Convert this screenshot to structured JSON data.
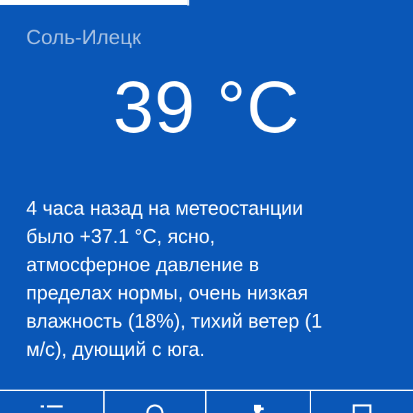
{
  "weather": {
    "city": "Соль-Илецк",
    "temperature": "39 °C",
    "description_lines": [
      "4 часа назад на метеостанции",
      "было +37.1 °C, ясно,",
      "атмосферное давление в",
      "пределах нормы, очень низкая",
      "влажность (18%), тихий ветер (1",
      "м/с), дующий с юга."
    ]
  },
  "toolbar": {
    "buttons": [
      {
        "icon": "list-icon"
      },
      {
        "icon": "search-icon"
      },
      {
        "icon": "wrench-icon"
      },
      {
        "icon": "window-icon"
      }
    ]
  },
  "colors": {
    "background": "#0a57b7",
    "city_text": "#a9c2e2",
    "text": "#ffffff"
  }
}
